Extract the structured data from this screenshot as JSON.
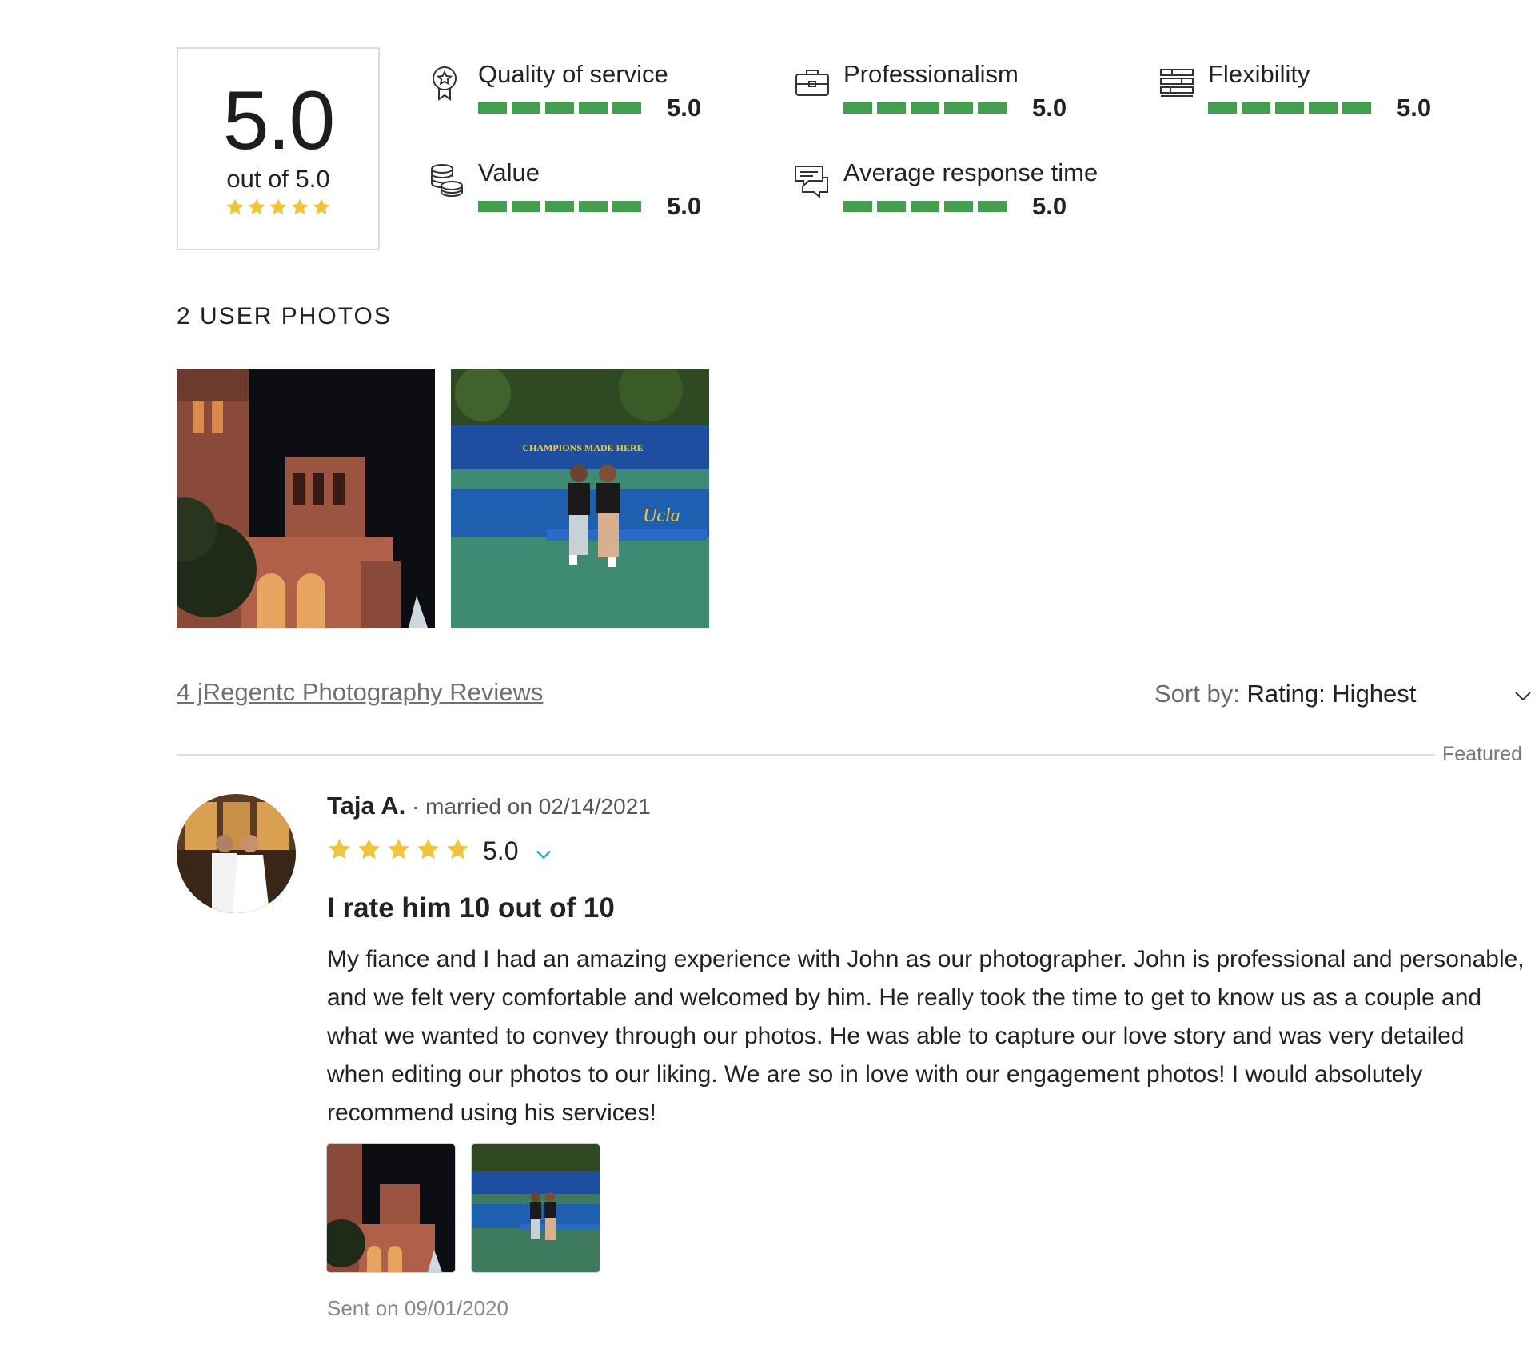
{
  "summary": {
    "overall_score": "5.0",
    "out_of_label": "out of 5.0",
    "overall_rating": 5.0
  },
  "categories": [
    {
      "label": "Quality of service",
      "value": "5.0",
      "icon": "award-ribbon-icon",
      "fill": 1.0
    },
    {
      "label": "Professionalism",
      "value": "5.0",
      "icon": "briefcase-icon",
      "fill": 1.0
    },
    {
      "label": "Flexibility",
      "value": "5.0",
      "icon": "stacked-layers-icon",
      "fill": 1.0
    },
    {
      "label": "Value",
      "value": "5.0",
      "icon": "coin-stack-icon",
      "fill": 1.0
    },
    {
      "label": "Average response time",
      "value": "5.0",
      "icon": "chat-bubbles-icon",
      "fill": 1.0
    }
  ],
  "user_photos": {
    "heading": "2 USER PHOTOS",
    "items": [
      "photo-night-building",
      "photo-couple-tennis-court"
    ]
  },
  "reviews_header": {
    "link_text": "4 jRegentc Photography Reviews",
    "sort_label": "Sort by:",
    "sort_value": "Rating: Highest",
    "featured_label": "Featured"
  },
  "review": {
    "name": "Taja A.",
    "meta": " · married on 02/14/2021",
    "rating": "5.0",
    "stars": 5,
    "title": "I rate him 10 out of 10",
    "body": "My fiance and I had an amazing experience with John as our photographer. John is professional and personable, and we felt very comfortable and welcomed by him. He really took the time to get to know us as a couple and what we wanted to convey through our photos. He was able to capture our love story and was very detailed when editing our photos to our liking. We are so in love with our engagement photos! I would absolutely recommend using his services!",
    "sent": "Sent on 09/01/2020"
  },
  "photo_text": {
    "banner": "CHAMPIONS MADE HERE",
    "team": "Ucla"
  },
  "colors": {
    "bar_green": "#439e4e",
    "star_gold": "#f0c43c",
    "chevron_teal": "#19b5b5"
  }
}
